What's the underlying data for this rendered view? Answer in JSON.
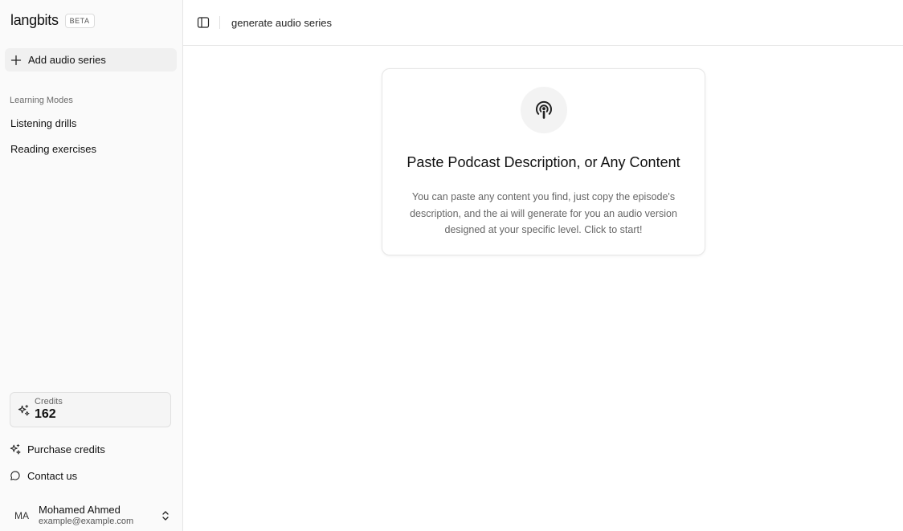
{
  "brand": {
    "name": "langbits",
    "badge": "BETA"
  },
  "sidebar": {
    "add_series_label": "Add audio series",
    "section_label": "Learning Modes",
    "items": [
      {
        "label": "Listening drills"
      },
      {
        "label": "Reading exercises"
      }
    ],
    "credits": {
      "label": "Credits",
      "value": "162"
    },
    "footer_links": [
      {
        "label": "Purchase credits",
        "icon": "sparkle-icon"
      },
      {
        "label": "Contact us",
        "icon": "chat-bubble-icon"
      }
    ],
    "user": {
      "initials": "MA",
      "name": "Mohamed Ahmed",
      "email": "example@example.com"
    }
  },
  "header": {
    "breadcrumb": "generate audio series"
  },
  "card": {
    "icon": "podcast-icon",
    "title": "Paste Podcast Description, or Any Content",
    "description": "You can paste any content you find, just copy the episode's description, and the ai will generate for you an audio version designed at your specific level. Click to start!"
  }
}
